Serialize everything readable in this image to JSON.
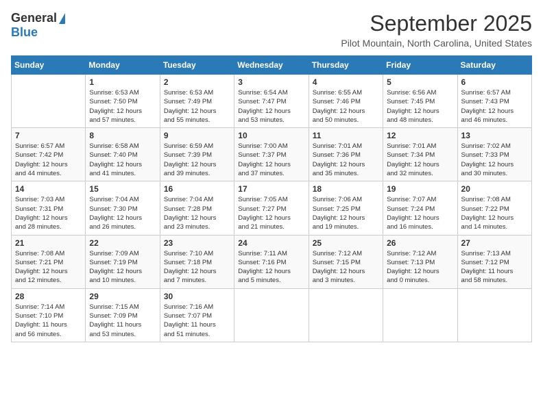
{
  "header": {
    "logo_general": "General",
    "logo_blue": "Blue",
    "month_title": "September 2025",
    "location": "Pilot Mountain, North Carolina, United States"
  },
  "days_of_week": [
    "Sunday",
    "Monday",
    "Tuesday",
    "Wednesday",
    "Thursday",
    "Friday",
    "Saturday"
  ],
  "weeks": [
    [
      {
        "day": "",
        "info": ""
      },
      {
        "day": "1",
        "info": "Sunrise: 6:53 AM\nSunset: 7:50 PM\nDaylight: 12 hours\nand 57 minutes."
      },
      {
        "day": "2",
        "info": "Sunrise: 6:53 AM\nSunset: 7:49 PM\nDaylight: 12 hours\nand 55 minutes."
      },
      {
        "day": "3",
        "info": "Sunrise: 6:54 AM\nSunset: 7:47 PM\nDaylight: 12 hours\nand 53 minutes."
      },
      {
        "day": "4",
        "info": "Sunrise: 6:55 AM\nSunset: 7:46 PM\nDaylight: 12 hours\nand 50 minutes."
      },
      {
        "day": "5",
        "info": "Sunrise: 6:56 AM\nSunset: 7:45 PM\nDaylight: 12 hours\nand 48 minutes."
      },
      {
        "day": "6",
        "info": "Sunrise: 6:57 AM\nSunset: 7:43 PM\nDaylight: 12 hours\nand 46 minutes."
      }
    ],
    [
      {
        "day": "7",
        "info": "Sunrise: 6:57 AM\nSunset: 7:42 PM\nDaylight: 12 hours\nand 44 minutes."
      },
      {
        "day": "8",
        "info": "Sunrise: 6:58 AM\nSunset: 7:40 PM\nDaylight: 12 hours\nand 41 minutes."
      },
      {
        "day": "9",
        "info": "Sunrise: 6:59 AM\nSunset: 7:39 PM\nDaylight: 12 hours\nand 39 minutes."
      },
      {
        "day": "10",
        "info": "Sunrise: 7:00 AM\nSunset: 7:37 PM\nDaylight: 12 hours\nand 37 minutes."
      },
      {
        "day": "11",
        "info": "Sunrise: 7:01 AM\nSunset: 7:36 PM\nDaylight: 12 hours\nand 35 minutes."
      },
      {
        "day": "12",
        "info": "Sunrise: 7:01 AM\nSunset: 7:34 PM\nDaylight: 12 hours\nand 32 minutes."
      },
      {
        "day": "13",
        "info": "Sunrise: 7:02 AM\nSunset: 7:33 PM\nDaylight: 12 hours\nand 30 minutes."
      }
    ],
    [
      {
        "day": "14",
        "info": "Sunrise: 7:03 AM\nSunset: 7:31 PM\nDaylight: 12 hours\nand 28 minutes."
      },
      {
        "day": "15",
        "info": "Sunrise: 7:04 AM\nSunset: 7:30 PM\nDaylight: 12 hours\nand 26 minutes."
      },
      {
        "day": "16",
        "info": "Sunrise: 7:04 AM\nSunset: 7:28 PM\nDaylight: 12 hours\nand 23 minutes."
      },
      {
        "day": "17",
        "info": "Sunrise: 7:05 AM\nSunset: 7:27 PM\nDaylight: 12 hours\nand 21 minutes."
      },
      {
        "day": "18",
        "info": "Sunrise: 7:06 AM\nSunset: 7:25 PM\nDaylight: 12 hours\nand 19 minutes."
      },
      {
        "day": "19",
        "info": "Sunrise: 7:07 AM\nSunset: 7:24 PM\nDaylight: 12 hours\nand 16 minutes."
      },
      {
        "day": "20",
        "info": "Sunrise: 7:08 AM\nSunset: 7:22 PM\nDaylight: 12 hours\nand 14 minutes."
      }
    ],
    [
      {
        "day": "21",
        "info": "Sunrise: 7:08 AM\nSunset: 7:21 PM\nDaylight: 12 hours\nand 12 minutes."
      },
      {
        "day": "22",
        "info": "Sunrise: 7:09 AM\nSunset: 7:19 PM\nDaylight: 12 hours\nand 10 minutes."
      },
      {
        "day": "23",
        "info": "Sunrise: 7:10 AM\nSunset: 7:18 PM\nDaylight: 12 hours\nand 7 minutes."
      },
      {
        "day": "24",
        "info": "Sunrise: 7:11 AM\nSunset: 7:16 PM\nDaylight: 12 hours\nand 5 minutes."
      },
      {
        "day": "25",
        "info": "Sunrise: 7:12 AM\nSunset: 7:15 PM\nDaylight: 12 hours\nand 3 minutes."
      },
      {
        "day": "26",
        "info": "Sunrise: 7:12 AM\nSunset: 7:13 PM\nDaylight: 12 hours\nand 0 minutes."
      },
      {
        "day": "27",
        "info": "Sunrise: 7:13 AM\nSunset: 7:12 PM\nDaylight: 11 hours\nand 58 minutes."
      }
    ],
    [
      {
        "day": "28",
        "info": "Sunrise: 7:14 AM\nSunset: 7:10 PM\nDaylight: 11 hours\nand 56 minutes."
      },
      {
        "day": "29",
        "info": "Sunrise: 7:15 AM\nSunset: 7:09 PM\nDaylight: 11 hours\nand 53 minutes."
      },
      {
        "day": "30",
        "info": "Sunrise: 7:16 AM\nSunset: 7:07 PM\nDaylight: 11 hours\nand 51 minutes."
      },
      {
        "day": "",
        "info": ""
      },
      {
        "day": "",
        "info": ""
      },
      {
        "day": "",
        "info": ""
      },
      {
        "day": "",
        "info": ""
      }
    ]
  ]
}
